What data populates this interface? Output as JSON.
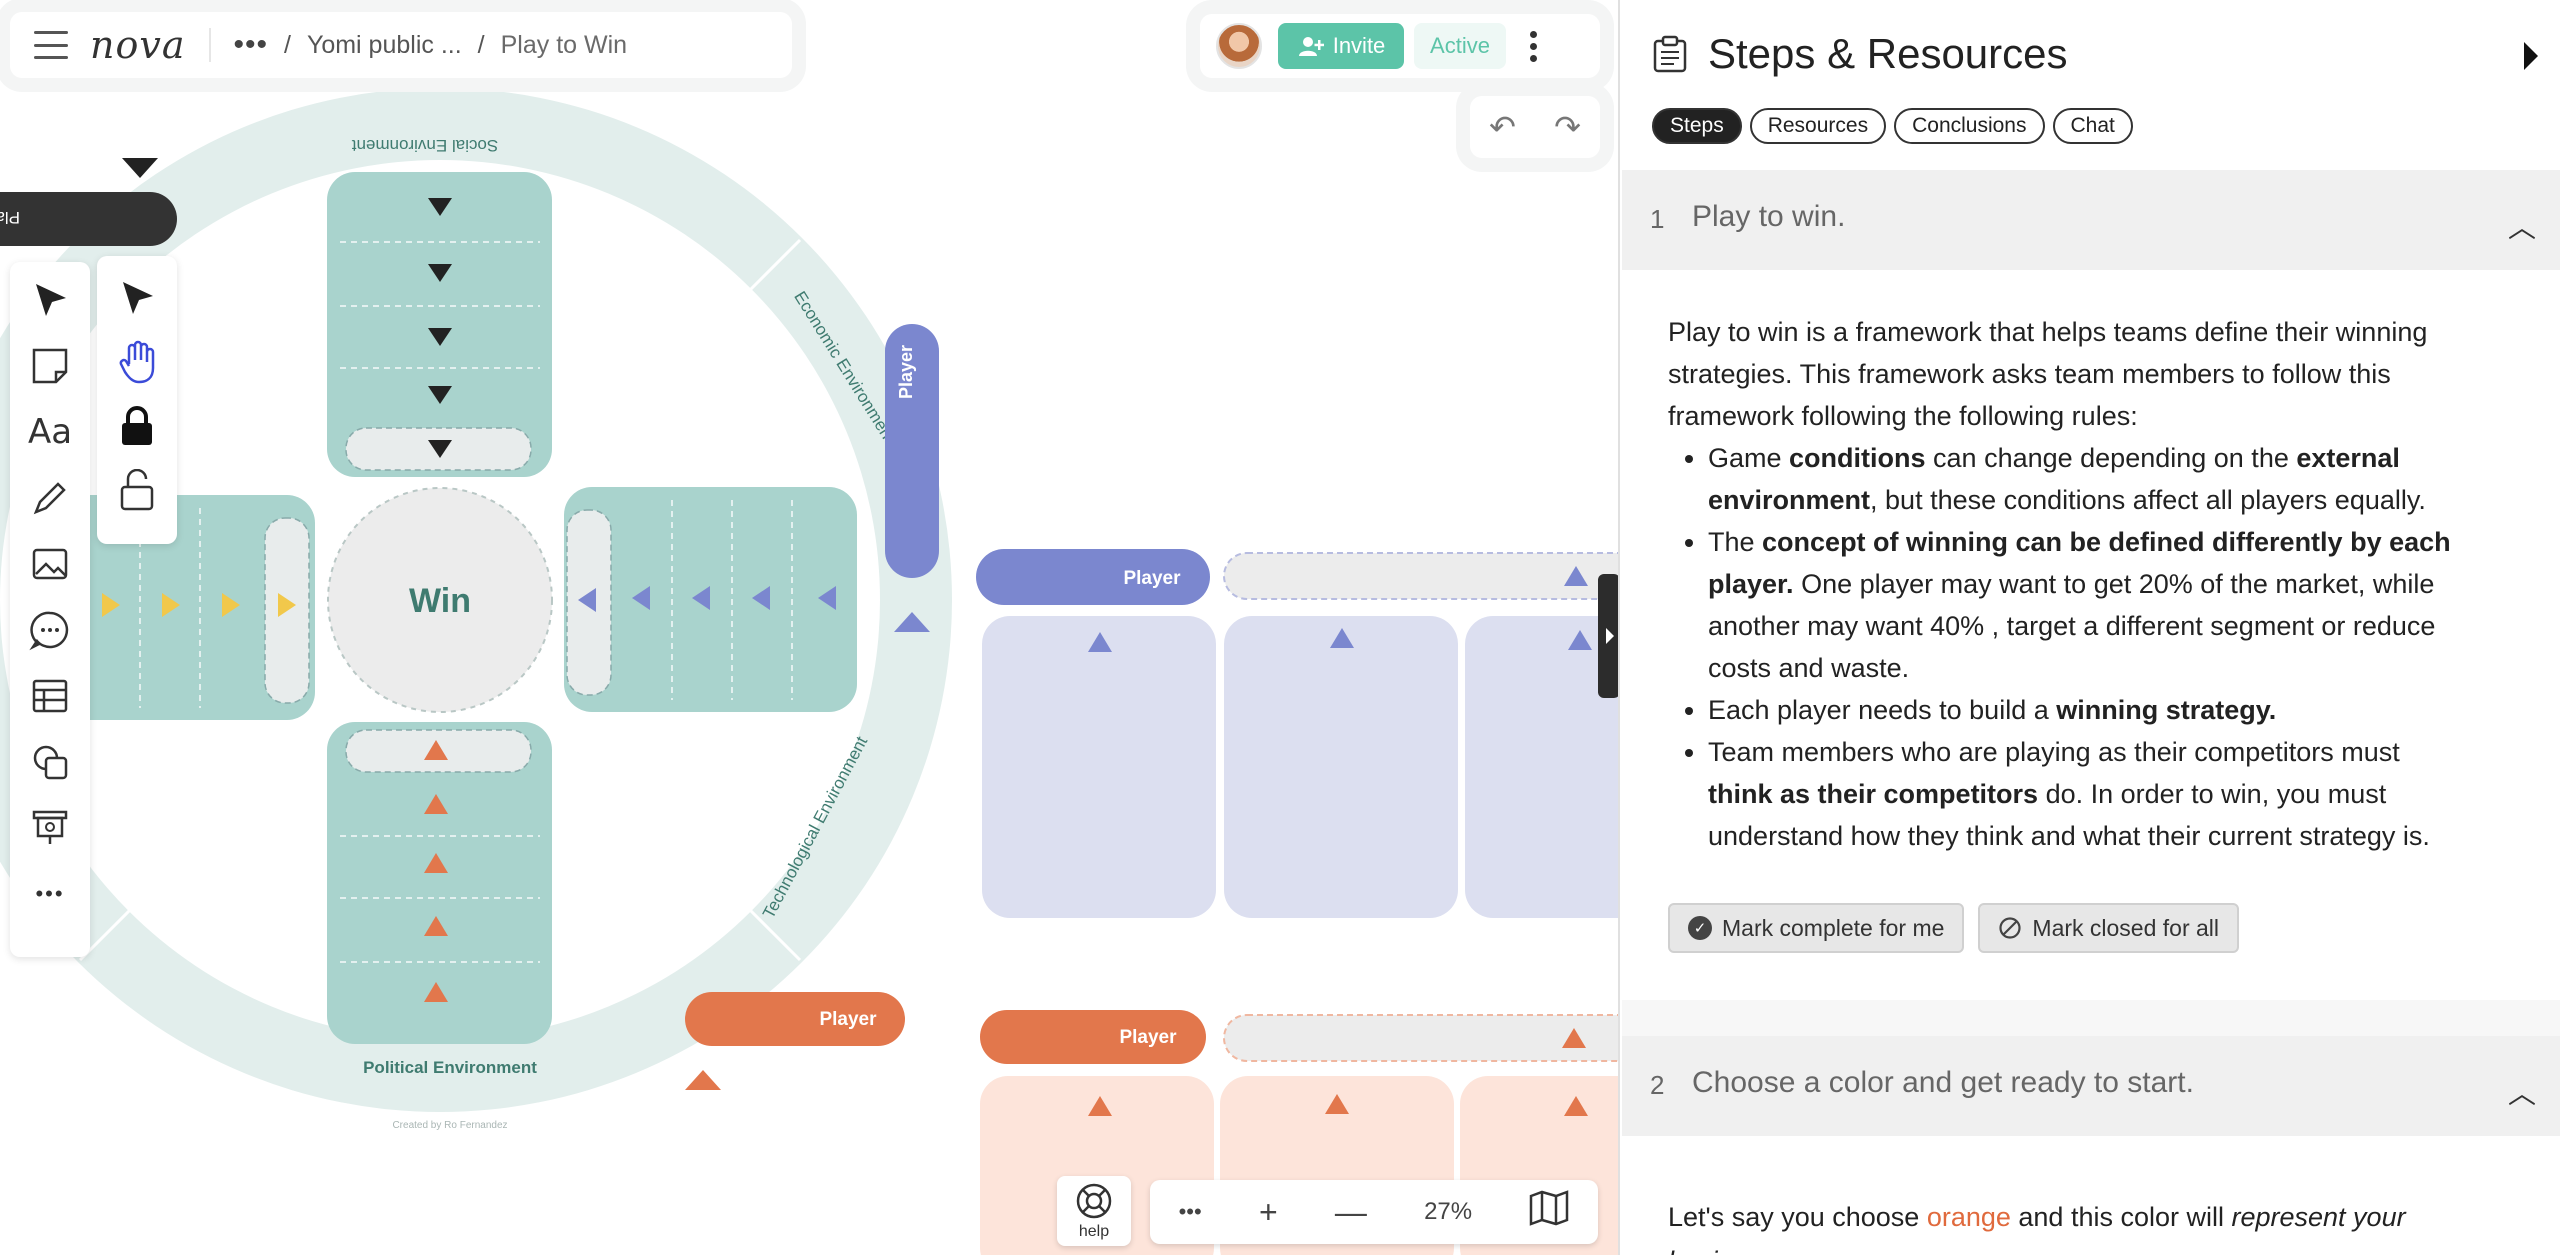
{
  "app": {
    "logo": "nova",
    "breadcrumb": [
      "Yomi public ...",
      "Play to Win"
    ],
    "invite_label": "Invite",
    "status_label": "Active"
  },
  "canvas": {
    "segment_labels": {
      "social": "Social Environment",
      "economic": "Economic Environment",
      "technological": "Technological Environment",
      "political": "Political Environment"
    },
    "center_label": "Win",
    "player_label": "Player",
    "dark_tab_label": "Player",
    "credit": "Created by Ro Fernandez",
    "colors": {
      "ring": "#e2eeec",
      "teal_box": "#a9d3cd",
      "teal_text": "#3f7b70",
      "purple": "#7b87cf",
      "purple_light": "#dcdff0",
      "orange": "#e2774c",
      "orange_light": "#fde4da"
    }
  },
  "tools": {
    "primary": [
      "select-arrow-icon",
      "sticky-note-icon",
      "text-icon",
      "pencil-icon",
      "image-icon",
      "comment-icon",
      "table-icon",
      "shapes-icon",
      "presentation-icon",
      "more-icon"
    ],
    "secondary": [
      "select-arrow-icon",
      "hand-icon",
      "lock-icon",
      "unlock-icon"
    ]
  },
  "bottom": {
    "help_label": "help",
    "zoom": "27%"
  },
  "panel": {
    "title": "Steps & Resources",
    "tabs": [
      "Steps",
      "Resources",
      "Conclusions",
      "Chat"
    ],
    "active_tab": "Steps",
    "steps": [
      {
        "number": "1",
        "title": "Play to win.",
        "intro": "Play to win is a framework that helps teams define their winning strategies. This framework asks team members to follow this framework following the following rules:",
        "bullets": [
          {
            "parts": [
              "Game ",
              "conditions",
              " can change depending on the ",
              "external environment",
              ", but these conditions affect all players equally."
            ]
          },
          {
            "parts": [
              "The ",
              "concept of winning can be defined differently by each player.",
              " One player may want to get 20% of the market, while another may want 40% , target a different segment or reduce costs and waste."
            ]
          },
          {
            "parts": [
              "Each player needs to build a ",
              "winning strategy.",
              ""
            ]
          },
          {
            "parts": [
              "Team members who are playing as their competitors must ",
              "think as their competitors",
              " do. In order to win, you must understand how they think and what their current strategy is."
            ]
          }
        ],
        "mark_complete": "Mark complete for me",
        "mark_closed": "Mark closed for all"
      },
      {
        "number": "2",
        "title": "Choose a color and get ready to start.",
        "body_before": "Let's say you choose ",
        "body_color_word": "orange",
        "body_middle": " and this color will ",
        "body_italic": "represent your business",
        "body_after": "."
      }
    ]
  }
}
